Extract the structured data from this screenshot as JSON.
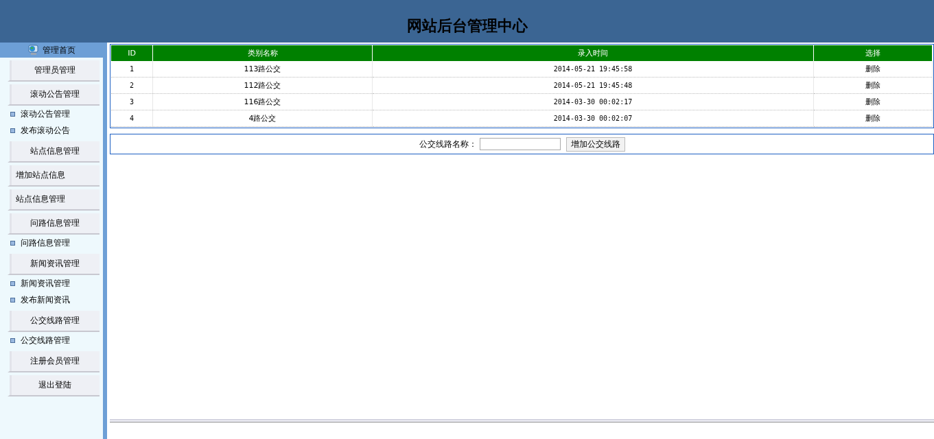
{
  "header": {
    "title": "网站后台管理中心"
  },
  "sidebar": {
    "title": "管理首页",
    "items": [
      {
        "kind": "section",
        "label": "管理员管理"
      },
      {
        "kind": "section",
        "label": "滚动公告管理"
      },
      {
        "kind": "link",
        "label": "滚动公告管理"
      },
      {
        "kind": "link",
        "label": "发布滚动公告"
      },
      {
        "kind": "section",
        "label": "站点信息管理"
      },
      {
        "kind": "plain",
        "label": "增加站点信息"
      },
      {
        "kind": "plain",
        "label": "站点信息管理"
      },
      {
        "kind": "section",
        "label": "问路信息管理"
      },
      {
        "kind": "link",
        "label": "问路信息管理"
      },
      {
        "kind": "section",
        "label": "新闻资讯管理"
      },
      {
        "kind": "link",
        "label": "新闻资讯管理"
      },
      {
        "kind": "link",
        "label": "发布新闻资讯"
      },
      {
        "kind": "section",
        "label": "公交线路管理"
      },
      {
        "kind": "link",
        "label": "公交线路管理"
      },
      {
        "kind": "section",
        "label": "注册会员管理"
      },
      {
        "kind": "section",
        "label": "退出登陆"
      }
    ]
  },
  "table": {
    "columns": [
      "ID",
      "类别名称",
      "录入时间",
      "选择"
    ],
    "rows": [
      {
        "id": "1",
        "name": "113路公交",
        "time": "2014-05-21 19:45:58",
        "action": "删除"
      },
      {
        "id": "2",
        "name": "112路公交",
        "time": "2014-05-21 19:45:48",
        "action": "删除"
      },
      {
        "id": "3",
        "name": "116路公交",
        "time": "2014-03-30 00:02:17",
        "action": "删除"
      },
      {
        "id": "4",
        "name": "4路公交",
        "time": "2014-03-30 00:02:07",
        "action": "删除"
      }
    ]
  },
  "form": {
    "label": "公交线路名称：",
    "button": "增加公交线路"
  }
}
